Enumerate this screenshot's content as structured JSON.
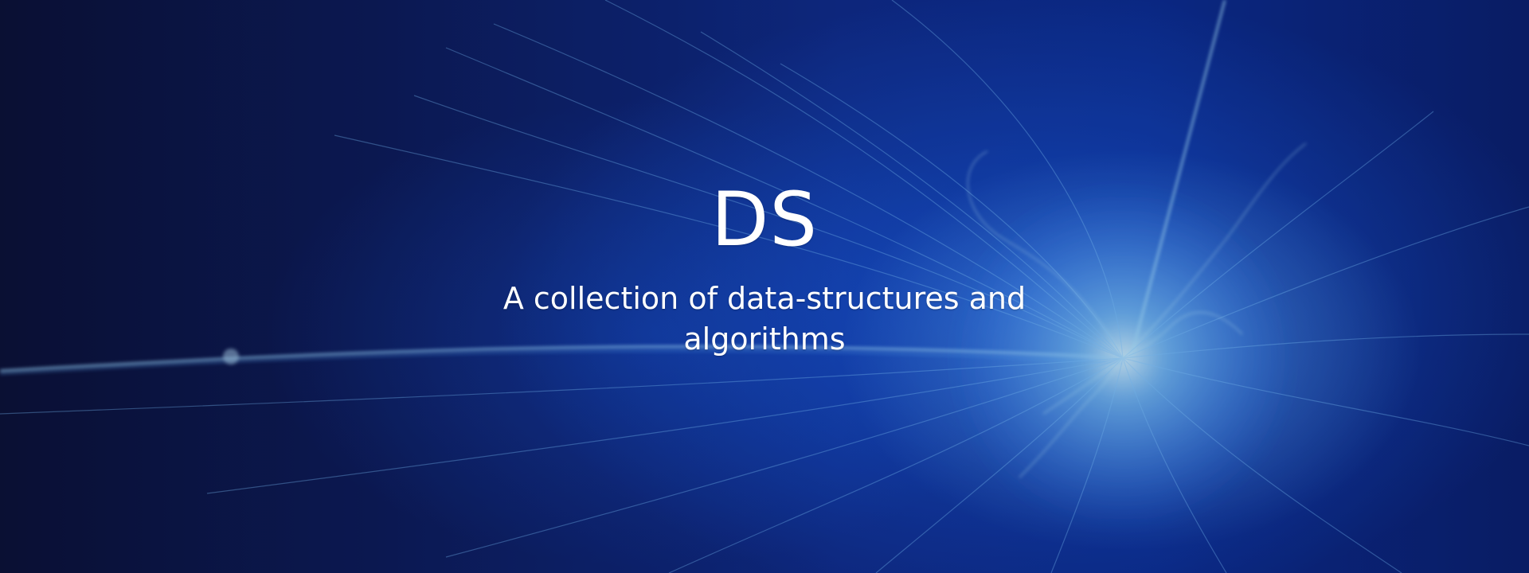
{
  "hero": {
    "title": "DS",
    "subtitle": "A collection of data-structures and algorithms"
  },
  "colors": {
    "background_dark": "#0b1033",
    "background_blue": "#0e2a86",
    "glow": "#7cc8ff",
    "text": "#ffffff"
  }
}
